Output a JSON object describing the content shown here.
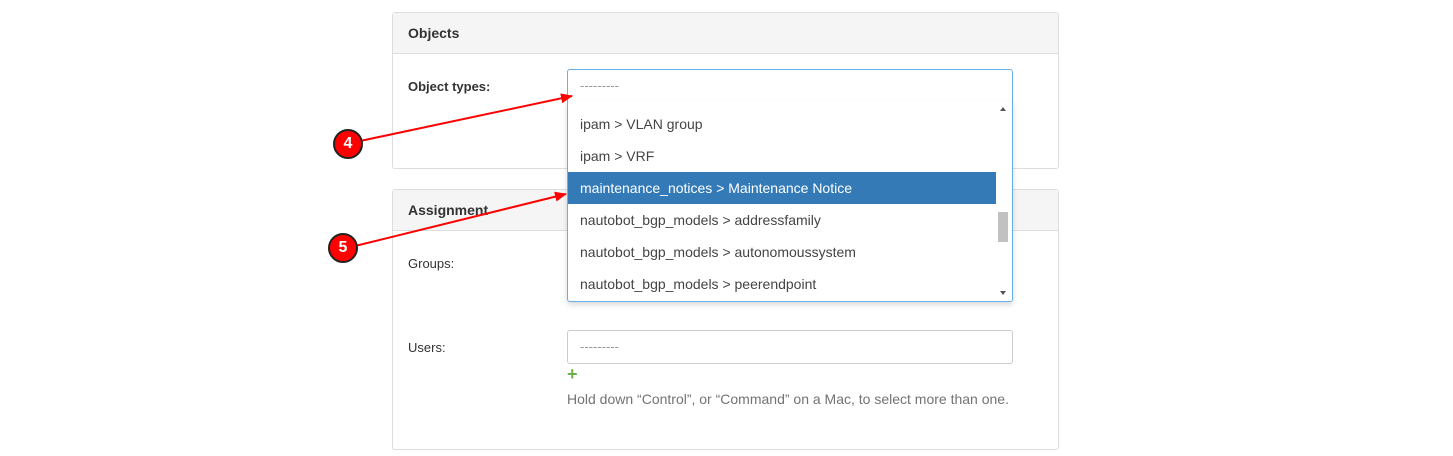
{
  "objects_panel": {
    "title": "Objects",
    "object_types_label": "Object types:",
    "object_types_placeholder": "---------",
    "dropdown_options": [
      {
        "label": "ipam > VLAN group",
        "selected": false
      },
      {
        "label": "ipam > VRF",
        "selected": false
      },
      {
        "label": "maintenance_notices > Maintenance Notice",
        "selected": true
      },
      {
        "label": "nautobot_bgp_models > addressfamily",
        "selected": false
      },
      {
        "label": "nautobot_bgp_models > autonomoussystem",
        "selected": false
      },
      {
        "label": "nautobot_bgp_models > peerendpoint",
        "selected": false
      }
    ]
  },
  "assignment_panel": {
    "title": "Assignment",
    "groups_label": "Groups:",
    "users_label": "Users:",
    "users_placeholder": "---------",
    "add_icon": "+",
    "help_text": "Hold down “Control”, or “Command” on a Mac, to select more than one."
  },
  "annotations": {
    "step4": "4",
    "step5": "5"
  },
  "colors": {
    "selected_bg": "#337ab7",
    "annotation_red": "#ff0000",
    "add_green": "#6ab04c"
  }
}
